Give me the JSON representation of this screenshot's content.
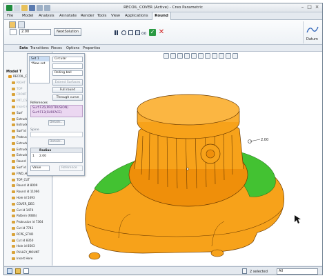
{
  "window": {
    "title": "RECOIL_COVER (Active) - Creo Parametric"
  },
  "menu": {
    "items": [
      "File",
      "Model",
      "Analysis",
      "Annotate",
      "Render",
      "Tools",
      "View",
      "Applications"
    ],
    "active_tab": "Round"
  },
  "ribbon": {
    "radius_value": "2.00",
    "next_solution_label": "NextSolution",
    "datum_label": "Datum"
  },
  "subtabs": [
    "Sets",
    "Transitions",
    "Pieces",
    "Options",
    "Properties"
  ],
  "panel": {
    "sets": [
      "Set 1",
      "*New set"
    ],
    "cross_section": "Circular",
    "spine_type": "Rolling ball",
    "extend_surfaces_label": "Extend Surfaces",
    "full_round_label": "Full round",
    "through_curve_label": "Through curve",
    "references_label": "References",
    "references": [
      "Surf:F35(PROTRUSION)",
      "Surf:F13(SURFACE)"
    ],
    "details_label": "Details...",
    "bone_label": "Spine",
    "details2_label": "Details...",
    "radius_col": "Radius",
    "row_index": "1",
    "row_radius": "2.00",
    "value_label": "Value",
    "reference_label": "Reference"
  },
  "tree": {
    "title": "Model T",
    "rows": [
      "RECOIL_COVER.PRT",
      "RIGHT",
      "TOP",
      "FRONT",
      "PRT_CSYS_DEF",
      "Insert Here",
      "Surf",
      "Extrude 1",
      "Extrude 2",
      "Surf id 95",
      "Protrusion",
      "Extrude 3",
      "Extrude 4",
      "Extrude 5",
      "Round id",
      "Surf id",
      "FWD_HOLE",
      "TOP_CUT",
      "Round id 8009",
      "Round id 11066",
      "Hole id 5493",
      "COVER_DEG",
      "Cut id 1474",
      "Pattern (RIBS)",
      "Protrusion id 7364",
      "Cut id 7741",
      "RCPE_STUD",
      "Cut id 8350",
      "Hole id 8503",
      "PULLEY_MOUNT",
      "Insert Here"
    ]
  },
  "status": {
    "selected_text": "2 selected",
    "filter_value": "All"
  },
  "colors": {
    "body_orange": "#f7a21a",
    "round_green": "#43c232",
    "edge_dark": "#6a3a00",
    "reference_purple": "#ebd7f1"
  }
}
